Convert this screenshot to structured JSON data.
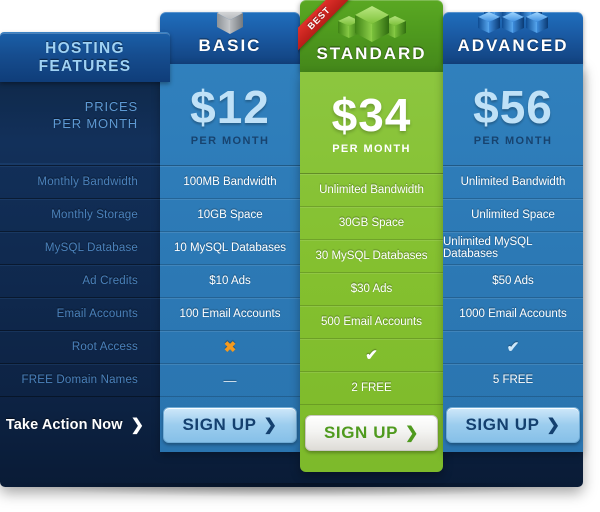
{
  "sidebar": {
    "header_line1": "HOSTING",
    "header_line2": "FEATURES",
    "price_label_line1": "PRICES",
    "price_label_line2": "PER MONTH",
    "features": [
      "Monthly Bandwidth",
      "Monthly Storage",
      "MySQL Database",
      "Ad Credits",
      "Email Accounts",
      "Root Access",
      "FREE Domain Names"
    ],
    "cta_label": "Take Action Now",
    "cta_arrow": "❯"
  },
  "badge": {
    "best_label": "BEST"
  },
  "plans": [
    {
      "name": "BASIC",
      "icon": "single-cube-icon",
      "price": "$12",
      "per_month": "PER MONTH",
      "values": [
        "100MB Bandwidth",
        "10GB Space",
        "10 MySQL Databases",
        "$10 Ads",
        "100 Email Accounts",
        "✖",
        "—"
      ],
      "signup_label": "SIGN UP",
      "signup_arrow": "❯"
    },
    {
      "name": "STANDARD",
      "icon": "triple-cube-icon",
      "price": "$34",
      "per_month": "PER MONTH",
      "values": [
        "Unlimited  Bandwidth",
        "30GB Space",
        "30 MySQL Databases",
        "$30 Ads",
        "500 Email Accounts",
        "✔",
        "2 FREE"
      ],
      "signup_label": "SIGN UP",
      "signup_arrow": "❯"
    },
    {
      "name": "ADVANCED",
      "icon": "cube-cluster-icon",
      "price": "$56",
      "per_month": "PER MONTH",
      "values": [
        "Unlimited Bandwidth",
        "Unlimited Space",
        "Unlimited MySQL Databases",
        "$50 Ads",
        "1000 Email Accounts",
        "✔",
        "5 FREE"
      ],
      "signup_label": "SIGN UP",
      "signup_arrow": "❯"
    }
  ],
  "colors": {
    "panel_dark": "#0e2746",
    "basic_blue": "#2c79b5",
    "standard_green": "#84c02f",
    "advanced_blue": "#2c79b5",
    "best_red": "#c8211c",
    "cross_orange": "#f59a1e"
  }
}
